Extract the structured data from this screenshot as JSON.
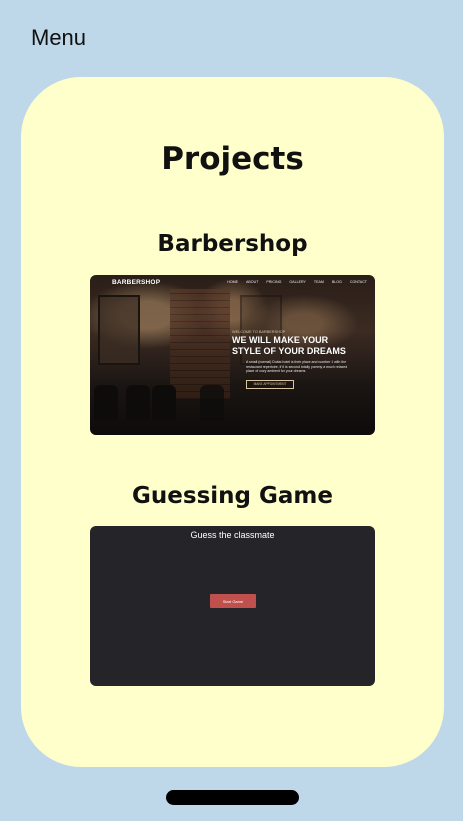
{
  "menu_label": "Menu",
  "page_title": "Projects",
  "projects": [
    {
      "title": "Barbershop",
      "preview": {
        "logo": "BARBERSHOP",
        "nav": [
          "HOME",
          "ABOUT",
          "PRICING",
          "GALLERY",
          "TEAM",
          "BLOG",
          "CONTACT"
        ],
        "eyebrow": "WELCOME TO BARBERSHOP",
        "headline_1": "WE WILL MAKE YOUR",
        "headline_2": "STYLE OF YOUR DREAMS",
        "body": "A small (normal) Dubai hotel is their place and number 1 with the restaurant repertoire, if it is second totally yummy a much relaxed place of cozy ambient for your dreams",
        "button": "MAKE APPOINTMENT"
      }
    },
    {
      "title": "Guessing Game",
      "preview": {
        "heading": "Guess the classmate",
        "button": "Start Game"
      }
    }
  ]
}
